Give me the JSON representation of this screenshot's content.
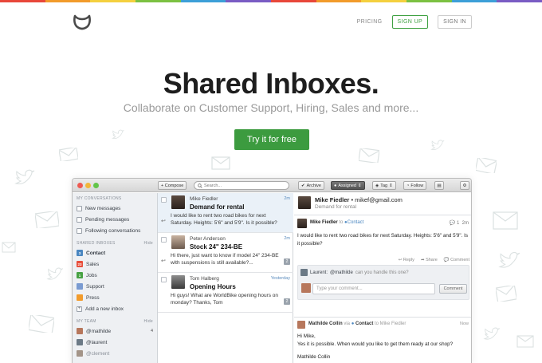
{
  "colors": {
    "rainbow": [
      "#e8473a",
      "#f29b2b",
      "#f4d03f",
      "#7cc142",
      "#3d9fd8",
      "#7a5cc4",
      "#e8473a",
      "#f29b2b",
      "#f4d03f",
      "#7cc142",
      "#3d9fd8",
      "#7a5cc4"
    ],
    "accent_green": "#3c9b3f",
    "badge_contact": "#4a86c0",
    "badge_sales": "#e84e3a",
    "badge_jobs": "#48a244",
    "badge_support": "#7a9bd1",
    "badge_press": "#f29b2b"
  },
  "nav": {
    "pricing": "PRICING",
    "signup": "SIGN UP",
    "signin": "SIGN IN"
  },
  "hero": {
    "title": "Shared Inboxes.",
    "subtitle": "Collaborate on Customer Support, Hiring, Sales and more...",
    "cta": "Try it for free"
  },
  "toolbar": {
    "compose": "+ Compose",
    "search_placeholder": "Search...",
    "archive": "Archive",
    "assigned": "Assigned",
    "tag": "Tag",
    "follow": "Follow"
  },
  "sidebar": {
    "my_conversations": "MY CONVERSATIONS",
    "items_top": [
      "New messages",
      "Pending messages",
      "Following conversations"
    ],
    "shared_inboxes": "SHARED INBOXES",
    "hide": "Hide",
    "inboxes": [
      {
        "badge": "3",
        "label": "Contact"
      },
      {
        "badge": "23",
        "label": "Sales"
      },
      {
        "badge": "1",
        "label": "Jobs"
      },
      {
        "badge": "",
        "label": "Support"
      },
      {
        "badge": "",
        "label": "Press"
      }
    ],
    "add_inbox": "Add a new inbox",
    "my_team": "MY TEAM",
    "team": [
      {
        "name": "@mathilde",
        "count": "4"
      },
      {
        "name": "@laurent",
        "count": ""
      },
      {
        "name": "@clement",
        "count": ""
      }
    ]
  },
  "messages": [
    {
      "from": "Mike Fiedler",
      "time": "2m",
      "subject": "Demand for rental",
      "preview": "I would like to rent two road bikes for next Saturday. Heights: 5'6\" and 5'9\". Is it possible?",
      "num": ""
    },
    {
      "from": "Peter Anderson",
      "time": "2m",
      "subject": "Stock 24\" 234-BE",
      "preview": "Hi there, just want to know if model 24\" 234-BE with suspensions is still available?...",
      "num": "2"
    },
    {
      "from": "Tom Halberg",
      "time": "Yesterday",
      "subject": "Opening Hours",
      "preview": "Hi guys! What are WorldBike opening hours on monday? Thanks, Tom",
      "num": "2"
    }
  ],
  "detail": {
    "from_name": "Mike Fiedler",
    "from_email": "mikef@gmail.com",
    "subject": "Demand for rental",
    "card_from": "Mike Fiedler",
    "card_to": "to",
    "card_inbox": "Contact",
    "card_count": "1",
    "card_time": "2m",
    "body": "I would like to rent two road bikes for next Saturday. Heights: 5'6\" and 5'9\". Is it possible?",
    "actions": [
      "Reply",
      "Share",
      "Comment"
    ],
    "comment_author": "Laurent:",
    "comment_mention": "@mathilde",
    "comment_text": "can you handle this one?",
    "comment_placeholder": "Type your comment...",
    "comment_button": "Comment",
    "reply_from": "Mathilde Collin",
    "reply_via": "via",
    "reply_inbox": "Contact",
    "reply_to": "to Mike Fiedler",
    "reply_time": "Now",
    "reply_line1": "Hi Mike,",
    "reply_line2": "Yes it is possible. When would you like to get them ready at our shop?",
    "reply_sign": "Mathilde Collin"
  }
}
